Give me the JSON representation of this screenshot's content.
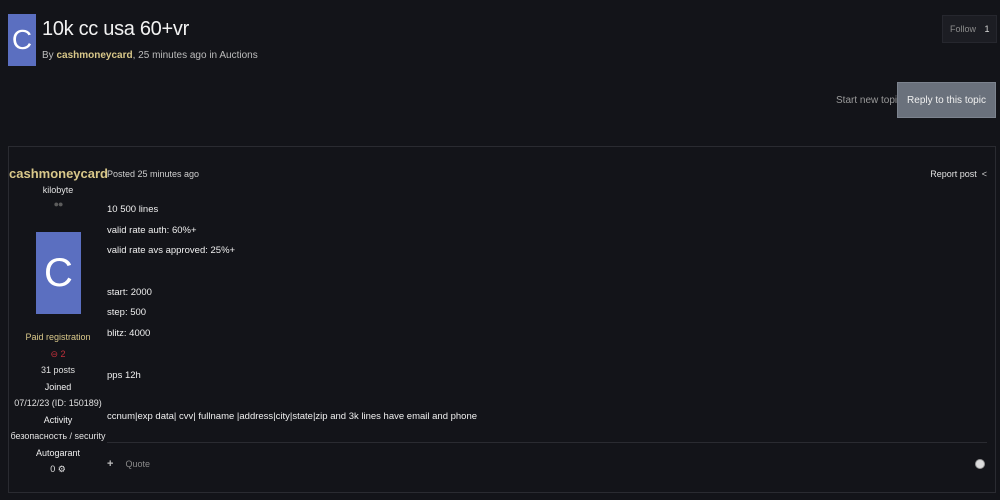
{
  "topic": {
    "avatar_letter": "C",
    "title": "10k cc usa 60+vr",
    "meta_prefix": "By ",
    "author": "cashmoneycard",
    "meta_suffix": ", 25 minutes ago in Auctions"
  },
  "follow": {
    "label": "Follow",
    "count": "1"
  },
  "actions": {
    "start_new_topic": "Start new topic",
    "reply": "Reply to this topic"
  },
  "post": {
    "author": {
      "name": "cashmoneycard",
      "rank": "kilobyte",
      "rank_dots": "●●",
      "avatar_letter": "C",
      "group": "Paid registration",
      "reputation": "⊖ 2",
      "posts": "31 posts",
      "joined_label": "Joined",
      "joined_value": "07/12/23 (ID: 150189)",
      "activity_label": "Activity",
      "activity_value": "безопасность / security",
      "autogarant_label": "Autogarant",
      "autogarant_value": "0"
    },
    "date": "Posted 25 minutes ago",
    "report": "Report post",
    "content": [
      "10 500 lines",
      "valid rate auth: 60%+",
      "valid rate avs approved: 25%+",
      "",
      "start: 2000",
      "step: 500",
      "blitz: 4000",
      "",
      "pps 12h",
      "",
      "ccnum|exp data| cvv| fullname |address|city|state|zip  and 3k lines have email and phone"
    ],
    "quote": "Quote"
  }
}
